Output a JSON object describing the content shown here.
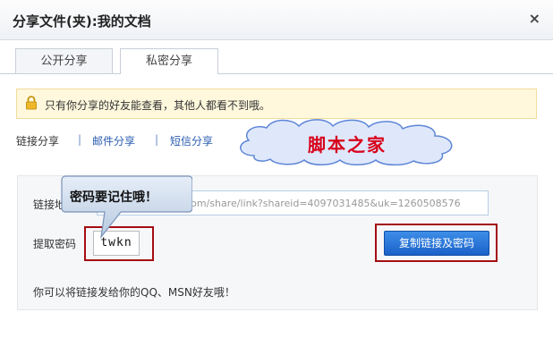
{
  "dialog": {
    "title": "分享文件(夹):我的文档",
    "close_label": "×"
  },
  "tabs": [
    {
      "label": "公开分享",
      "active": false
    },
    {
      "label": "私密分享",
      "active": true
    }
  ],
  "notice": {
    "icon": "lock-icon",
    "text": "只有你分享的好友能查看，其他人都看不到哦。"
  },
  "share_methods": [
    {
      "label": "链接分享",
      "active": true
    },
    {
      "separator": "|",
      "label": "邮件分享",
      "active": false
    },
    {
      "separator": "|",
      "label": "短信分享",
      "active": false
    }
  ],
  "watermark": {
    "text": "脚本之家"
  },
  "callout": {
    "text": "密码要记住哦！"
  },
  "link": {
    "label": "链接地址",
    "value": "http://pan.baidu.com/share/link?shareid=4097031485&uk=1260508576"
  },
  "password": {
    "label": "提取密码",
    "value": "twkn"
  },
  "copy_button": {
    "label": "复制链接及密码"
  },
  "footnote": "你可以将链接发给你的QQ、MSN好友哦！",
  "colors": {
    "accent": "#1a61c9",
    "highlight": "#a40d12",
    "watermark": "#d8001a",
    "notice_bg": "#fff8dd"
  }
}
